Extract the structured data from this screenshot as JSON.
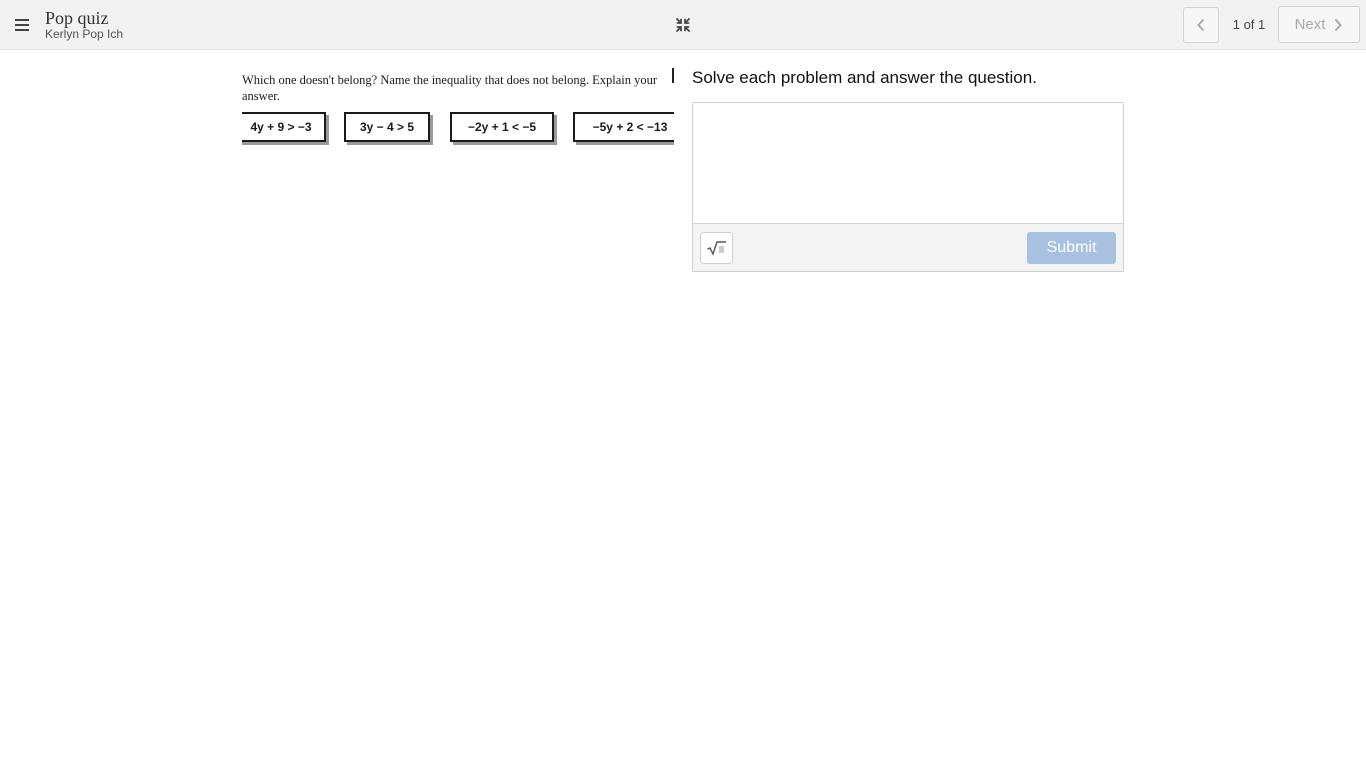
{
  "header": {
    "title": "Pop quiz",
    "subtitle": "Kerlyn Pop Ich",
    "page_count": "1 of 1",
    "next_label": "Next"
  },
  "question_image": {
    "line1": "Which one doesn't belong?  Name the inequality that does not belong.  Explain your",
    "line2": "answer.",
    "inequalities": [
      "4y + 9 > −3",
      "3y − 4 > 5",
      "−2y + 1 < −5",
      "−5y + 2 < −13"
    ]
  },
  "answer_panel": {
    "prompt": "Solve each problem and answer the question.",
    "submit_label": "Submit"
  },
  "colors": {
    "topbar_bg": "#f2f2f2",
    "submit_disabled": "#a8c1e0"
  }
}
